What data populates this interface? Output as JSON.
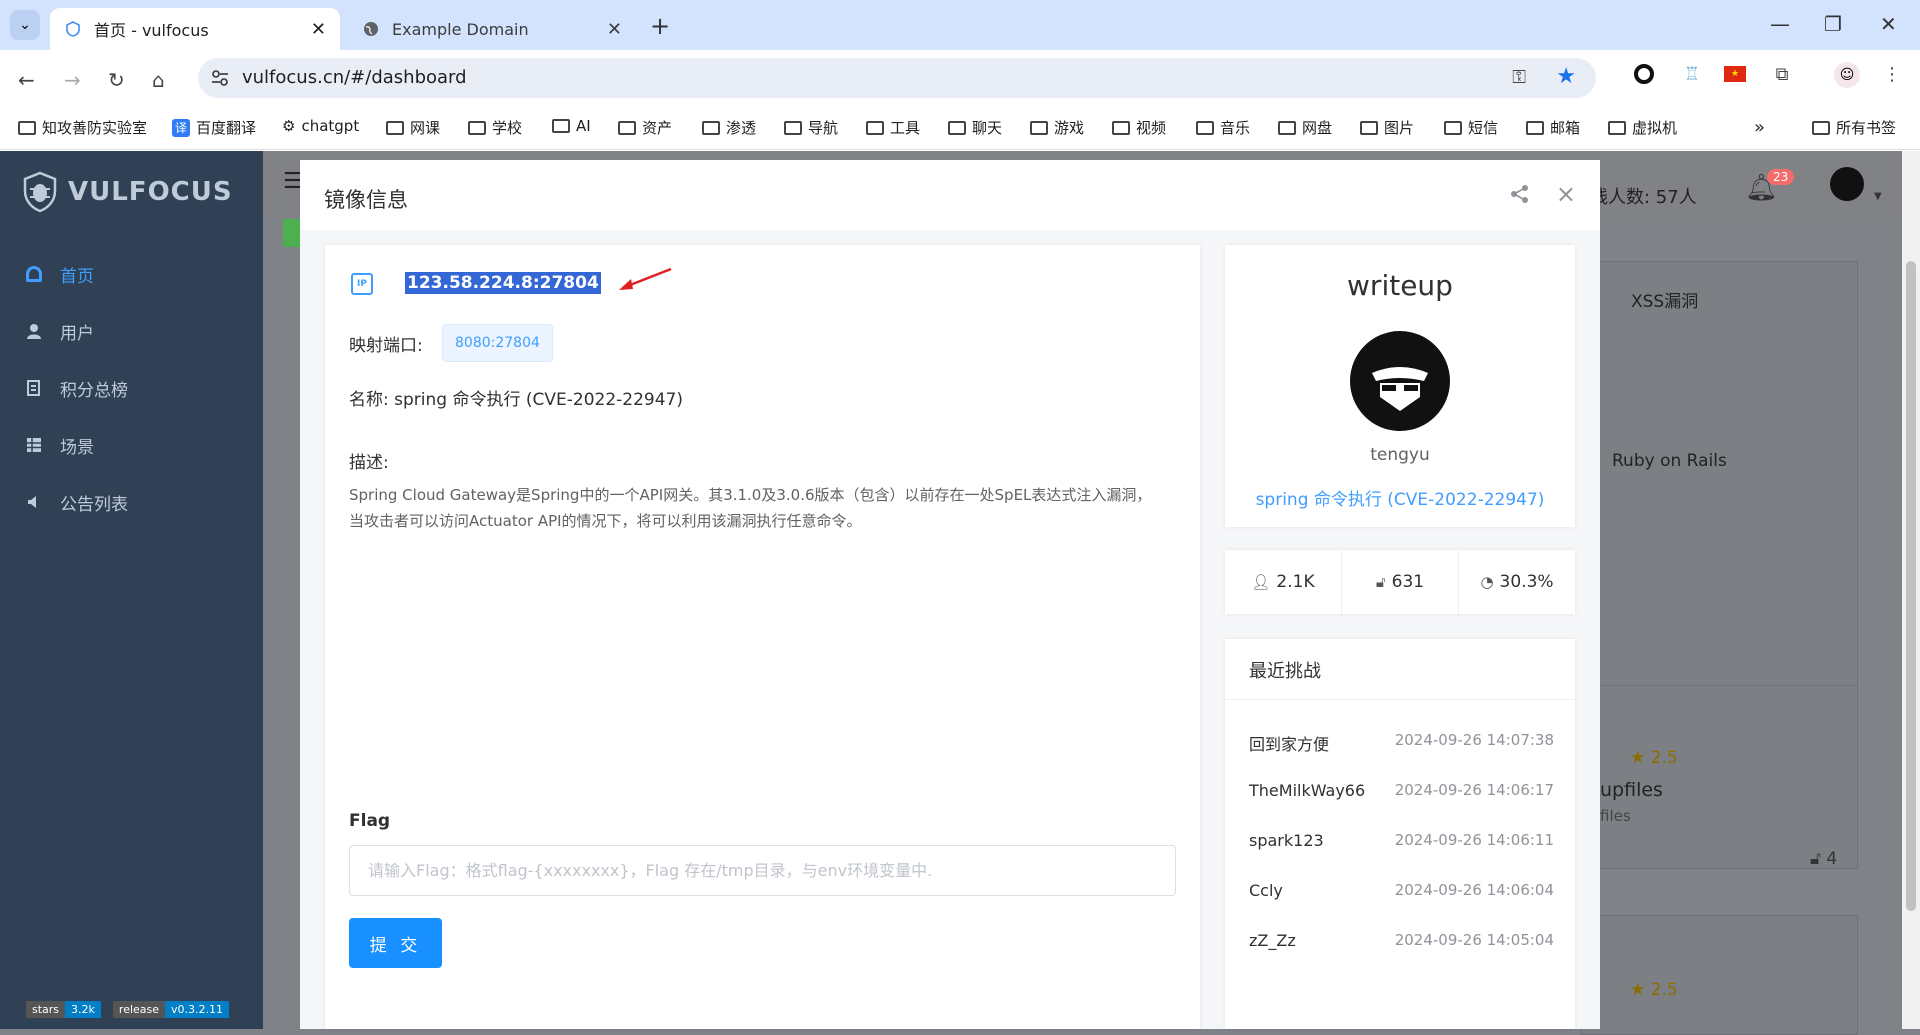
{
  "browser": {
    "tabs": [
      {
        "title": "首页 - vulfocus",
        "active": true
      },
      {
        "title": "Example Domain",
        "active": false
      }
    ],
    "url": "vulfocus.cn/#/dashboard",
    "bookmarks": [
      "知攻善防实验室",
      "百度翻译",
      "chatgpt",
      "网课",
      "学校",
      "AI",
      "资产",
      "渗透",
      "导航",
      "工具",
      "聊天",
      "游戏",
      "视频",
      "音乐",
      "网盘",
      "图片",
      "短信",
      "邮箱",
      "虚拟机"
    ],
    "all_bookmarks": "所有书签",
    "more": "»"
  },
  "sidebar": {
    "logo": "VULFOCUS",
    "items": [
      {
        "label": "首页",
        "icon": "dashboard-icon",
        "active": true
      },
      {
        "label": "用户",
        "icon": "user-icon",
        "active": false
      },
      {
        "label": "积分总榜",
        "icon": "ranking-icon",
        "active": false
      },
      {
        "label": "场景",
        "icon": "table-icon",
        "active": false
      },
      {
        "label": "公告列表",
        "icon": "speaker-icon",
        "active": false
      }
    ],
    "badges": {
      "stars_label": "stars",
      "stars_value": "3.2k",
      "release_label": "release",
      "release_value": "v0.3.2.11"
    }
  },
  "header": {
    "online": "线人数: 57人",
    "notifications": "23"
  },
  "background": {
    "xss": "XSS漏洞",
    "ruby": "Ruby on Rails",
    "rating1": "2.5",
    "upfiles": "upfiles",
    "files": "files",
    "count": "4",
    "rating2": "2.5"
  },
  "modal": {
    "title": "镜像信息",
    "ip": "123.58.224.8:27804",
    "port_label": "映射端口:",
    "port_value": "8080:27804",
    "name": "名称: spring 命令执行 (CVE-2022-22947)",
    "desc_label": "描述:",
    "description": "Spring Cloud Gateway是Spring中的一个API网关。其3.1.0及3.0.6版本（包含）以前存在一处SpEL表达式注入漏洞，当攻击者可以访问Actuator API的情况下，将可以利用该漏洞执行任意命令。",
    "flag_label": "Flag",
    "flag_placeholder": "请输入Flag：格式flag-{xxxxxxxx}，Flag 存在/tmp目录，与env环境变量中.",
    "submit": "提 交",
    "writeup": {
      "title": "writeup",
      "author": "tengyu",
      "link": "spring 命令执行 (CVE-2022-22947)"
    },
    "stats": {
      "users": "2.1K",
      "solved": "631",
      "rate": "30.3%"
    },
    "recent": {
      "title": "最近挑战",
      "rows": [
        {
          "user": "回到家方便",
          "time": "2024-09-26 14:07:38"
        },
        {
          "user": "TheMilkWay66",
          "time": "2024-09-26 14:06:17"
        },
        {
          "user": "spark123",
          "time": "2024-09-26 14:06:11"
        },
        {
          "user": "Ccly",
          "time": "2024-09-26 14:06:04"
        },
        {
          "user": "zZ_Zz",
          "time": "2024-09-26 14:05:04"
        }
      ]
    }
  },
  "colors": {
    "accent": "#409eff",
    "sidebar": "#304156",
    "selection": "#3367d6"
  }
}
